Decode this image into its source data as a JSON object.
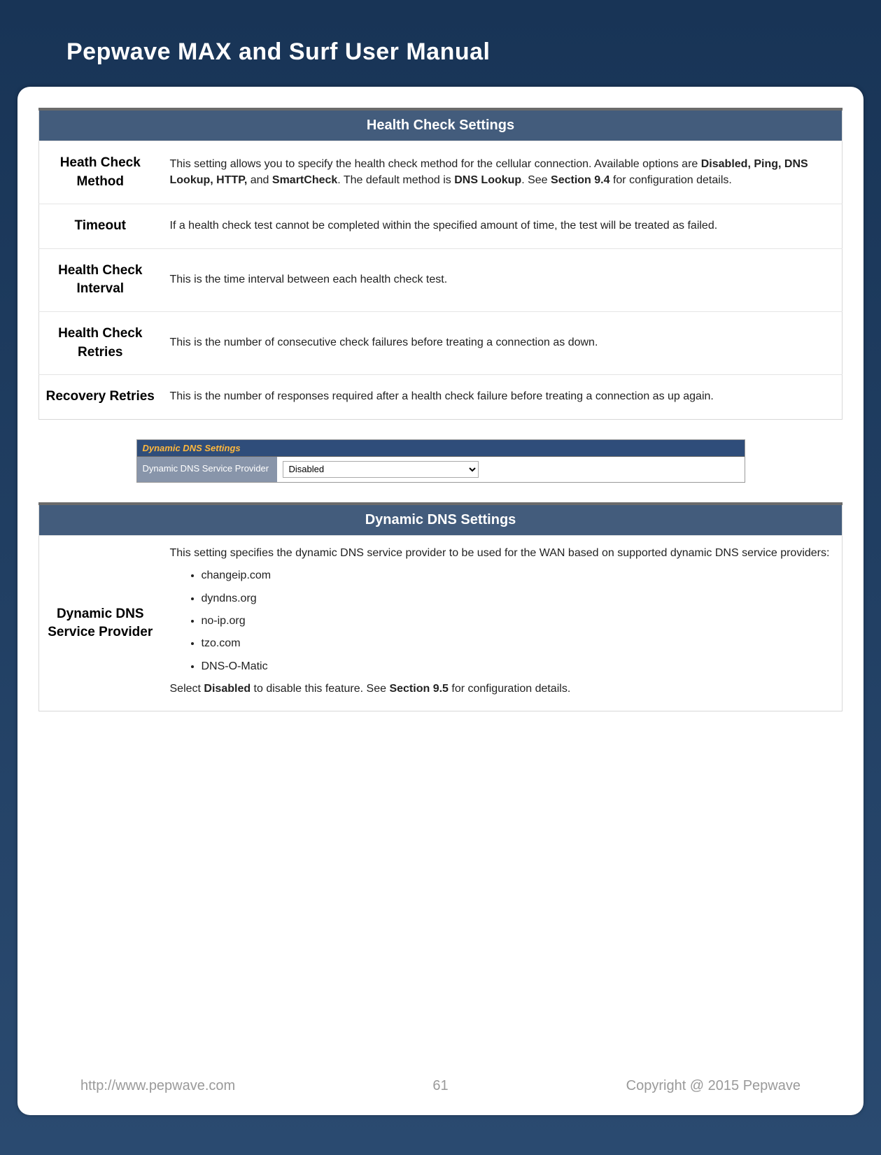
{
  "header": {
    "title": "Pepwave MAX and Surf User Manual"
  },
  "health_check": {
    "section_title": "Health Check Settings",
    "rows": {
      "method": {
        "label": "Heath Check Method",
        "text_pre": "This setting allows you to specify the health check method for the cellular connection. Available options are ",
        "bold1": "Disabled, Ping, DNS Lookup, HTTP,",
        "mid1": " and ",
        "bold2": "SmartCheck",
        "mid2": ". The default method is ",
        "bold3": "DNS Lookup",
        "mid3": ". See ",
        "bold4": "Section 9.4",
        "tail": " for configuration details."
      },
      "timeout": {
        "label": "Timeout",
        "text": "If a health check test cannot be completed within the specified amount of time, the test will be treated as failed."
      },
      "interval": {
        "label": "Health Check Interval",
        "text": "This is the time interval between each health check test."
      },
      "retries": {
        "label": "Health Check Retries",
        "text": "This is the number of consecutive check failures before treating a connection as down."
      },
      "recovery": {
        "label": "Recovery Retries",
        "text": "This is the number of responses required after a health check failure before treating a connection as up again."
      }
    }
  },
  "panel": {
    "title": "Dynamic DNS Settings",
    "left_label": "Dynamic DNS Service Provider",
    "selected": "Disabled"
  },
  "ddns": {
    "section_title": "Dynamic DNS Settings",
    "row": {
      "label": "Dynamic DNS Service Provider",
      "intro": "This setting specifies the dynamic DNS service provider to be used for the WAN based on supported dynamic DNS service providers:",
      "items": [
        "changeip.com",
        "dyndns.org",
        "no-ip.org",
        "tzo.com",
        "DNS-O-Matic"
      ],
      "outro_pre": "Select ",
      "outro_bold1": "Disabled",
      "outro_mid": " to disable this feature. See ",
      "outro_bold2": "Section 9.5",
      "outro_tail": " for configuration details."
    }
  },
  "footer": {
    "url": "http://www.pepwave.com",
    "page": "61",
    "copy": "Copyright @ 2015 Pepwave"
  }
}
